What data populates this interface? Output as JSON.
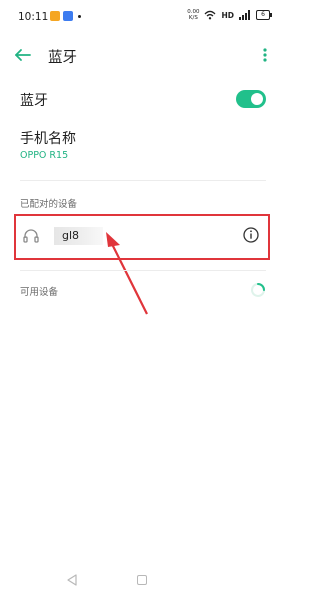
{
  "status_bar": {
    "time": "10:11",
    "network_speed_value": "0.00",
    "network_speed_unit": "K/S",
    "hd_label": "HD",
    "battery_level": "6"
  },
  "header": {
    "title": "蓝牙"
  },
  "bluetooth": {
    "label": "蓝牙",
    "enabled": true
  },
  "phone_name": {
    "label": "手机名称",
    "value": "OPPO R15"
  },
  "paired_devices": {
    "section_title": "已配对的设备",
    "items": [
      {
        "name": "gl8",
        "icon": "headphone-icon",
        "action_icon": "info-icon"
      }
    ]
  },
  "available_devices": {
    "section_title": "可用设备"
  },
  "colors": {
    "accent": "#21c08b",
    "highlight": "#e0353b"
  }
}
